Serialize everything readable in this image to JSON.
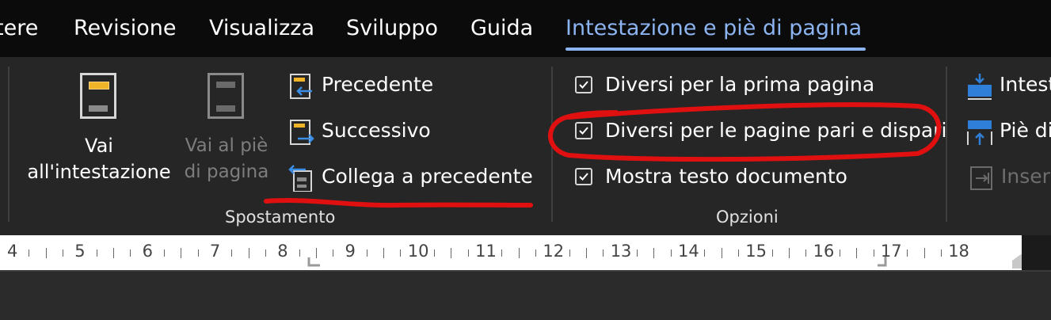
{
  "tabs": [
    {
      "label": "tere"
    },
    {
      "label": "Revisione"
    },
    {
      "label": "Visualizza"
    },
    {
      "label": "Sviluppo"
    },
    {
      "label": "Guida"
    },
    {
      "label": "Intestazione e piè di pagina",
      "active": true
    }
  ],
  "navigation": {
    "goto_header": {
      "line1": "Vai",
      "line2": "all'intestazione"
    },
    "goto_footer": {
      "line1": "Vai al piè",
      "line2": "di pagina"
    },
    "previous": "Precedente",
    "next": "Successivo",
    "link_previous": "Collega a precedente",
    "group_label": "Spostamento"
  },
  "options": {
    "different_first_page": {
      "label": "Diversi per la prima pagina",
      "checked": true
    },
    "different_odd_even": {
      "label": "Diversi per le pagine pari e dispari",
      "checked": true
    },
    "show_document_text": {
      "label": "Mostra testo documento",
      "checked": true
    },
    "group_label": "Opzioni"
  },
  "position": {
    "header_from_top": "Intest",
    "footer_from_bottom": "Piè di",
    "insert_alignment_tab": "Inseri"
  },
  "ruler": {
    "numbers": [
      "4",
      "5",
      "6",
      "7",
      "8",
      "9",
      "10",
      "11",
      "12",
      "13",
      "14",
      "15",
      "16",
      "17",
      "18"
    ]
  },
  "colors": {
    "accent": "#8cb4f0",
    "annotation": "#e01010",
    "header_bar": "#f0b429",
    "arrow": "#3a8ee6",
    "position_icon": "#2f7fd8"
  },
  "icons": {
    "goto_header": "header-doc-icon",
    "goto_footer": "footer-doc-icon",
    "previous": "previous-section-icon",
    "next": "next-section-icon",
    "link": "link-to-previous-icon",
    "header_position": "header-position-icon",
    "footer_position": "footer-position-icon",
    "alignment_tab": "insert-alignment-tab-icon"
  }
}
